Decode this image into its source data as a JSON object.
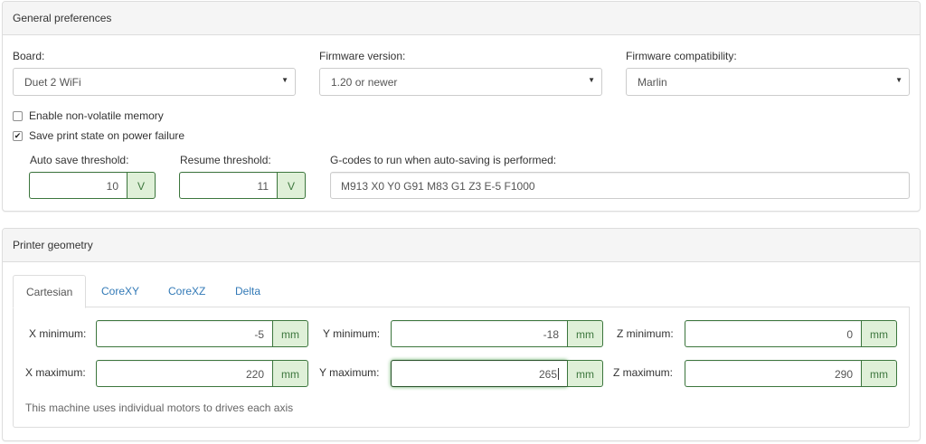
{
  "general": {
    "title": "General preferences",
    "board": {
      "label": "Board:",
      "value": "Duet 2 WiFi"
    },
    "firmware_version": {
      "label": "Firmware version:",
      "value": "1.20 or newer"
    },
    "firmware_compat": {
      "label": "Firmware compatibility:",
      "value": "Marlin"
    },
    "caret": "▼",
    "nvram": {
      "label": "Enable non-volatile memory",
      "checked": false
    },
    "save_state": {
      "label": "Save print state on power failure",
      "checked": true,
      "mark": "✔"
    },
    "auto_save": {
      "label": "Auto save threshold:",
      "value": "10",
      "unit": "V"
    },
    "resume": {
      "label": "Resume threshold:",
      "value": "11",
      "unit": "V"
    },
    "gcodes": {
      "label": "G-codes to run when auto-saving is performed:",
      "value": "M913 X0 Y0 G91 M83 G1 Z3 E-5 F1000"
    }
  },
  "geometry": {
    "title": "Printer geometry",
    "tabs": [
      {
        "label": "Cartesian",
        "active": true
      },
      {
        "label": "CoreXY",
        "active": false
      },
      {
        "label": "CoreXZ",
        "active": false
      },
      {
        "label": "Delta",
        "active": false
      }
    ],
    "unit": "mm",
    "x_min": {
      "label": "X minimum:",
      "value": "-5"
    },
    "y_min": {
      "label": "Y minimum:",
      "value": "-18"
    },
    "z_min": {
      "label": "Z minimum:",
      "value": "0"
    },
    "x_max": {
      "label": "X maximum:",
      "value": "220"
    },
    "y_max": {
      "label": "Y maximum:",
      "value": "265"
    },
    "z_max": {
      "label": "Z maximum:",
      "value": "290"
    },
    "hint": "This machine uses individual motors to drives each axis"
  },
  "colors": {
    "success_border": "#3c763d",
    "success_bg": "#dff0d8",
    "link": "#337ab7"
  }
}
